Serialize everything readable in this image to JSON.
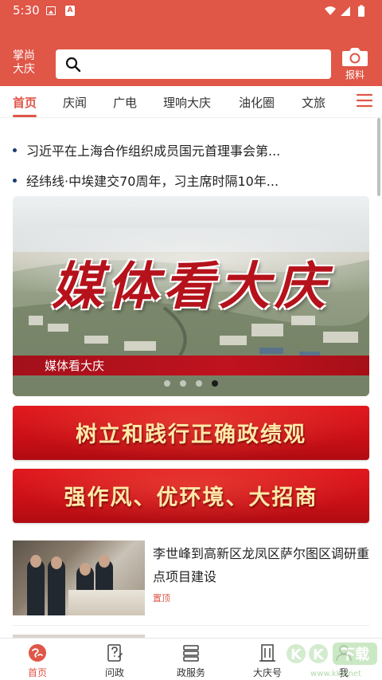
{
  "status_bar": {
    "time": "5:30",
    "badge": "A"
  },
  "header": {
    "brand_line1": "掌尚",
    "brand_line2": "大庆",
    "search_placeholder": "",
    "report_label": "报料"
  },
  "tabs": [
    {
      "label": "首页",
      "active": true
    },
    {
      "label": "庆闻",
      "active": false
    },
    {
      "label": "广电",
      "active": false
    },
    {
      "label": "理响大庆",
      "active": false
    },
    {
      "label": "油化圈",
      "active": false
    },
    {
      "label": "文旅",
      "active": false
    }
  ],
  "headlines": [
    "习近平在上海合作组织成员国元首理事会第...",
    "经纬线·中埃建交70周年，习主席时隔10年..."
  ],
  "banner": {
    "title": "媒体看大庆",
    "caption": "媒体看大庆",
    "page_count": 4,
    "active_index": 3
  },
  "promos": [
    "树立和践行正确政绩观",
    "强作风、优环境、大招商"
  ],
  "news": [
    {
      "title": "李世峰到高新区龙凤区萨尔图区调研重点项目建设",
      "tag": "置顶"
    }
  ],
  "bottom_nav": [
    {
      "label": "首页",
      "icon": "home-globe-icon",
      "active": true
    },
    {
      "label": "问政",
      "icon": "inquiry-icon",
      "active": false
    },
    {
      "label": "政服务",
      "icon": "server-icon",
      "active": false
    },
    {
      "label": "大庆号",
      "icon": "building-icon",
      "active": false
    },
    {
      "label": "我",
      "icon": "user-icon",
      "active": false
    }
  ],
  "watermark": "KK下载 www.kkx.net",
  "colors": {
    "accent": "#e05647",
    "promo_red": "#c90f16",
    "promo_text": "#ffe9a8",
    "bullet": "#1a3d6e"
  }
}
